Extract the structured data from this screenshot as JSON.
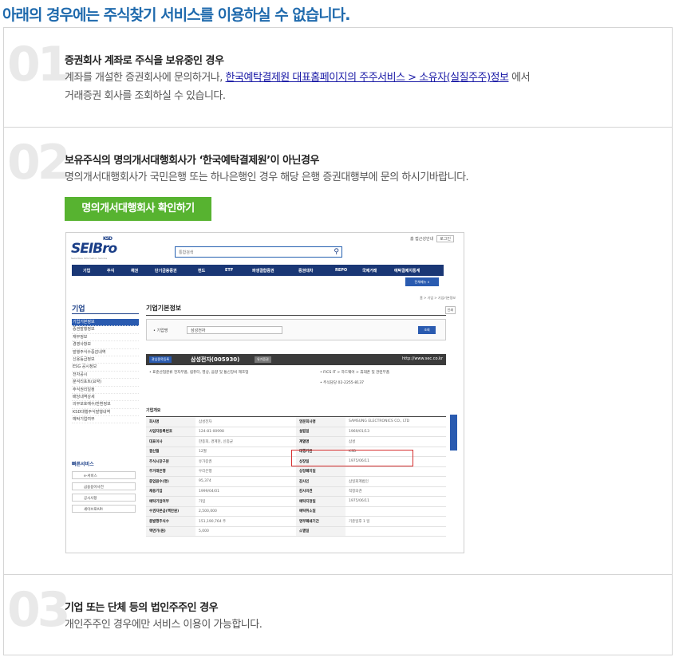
{
  "page_title": "아래의 경우에는 주식찾기 서비스를 이용하실 수 없습니다.",
  "sections": [
    {
      "number": "01",
      "heading": "증권회사 계좌로 주식을 보유중인 경우",
      "desc_prefix": "계좌를 개설한 증권회사에 문의하거나,",
      "link_text": "한국예탁결제원 대표홈페이지의 주주서비스 > 소유자(실질주주)정보",
      "desc_suffix": "에서",
      "desc_line2": "거래증권 회사를 조회하실 수 있습니다."
    },
    {
      "number": "02",
      "heading": "보유주식의 명의개서대행회사가 ‘한국예탁결제원’이 아닌경우",
      "desc": "명의개서대행회사가 국민은행 또는 하나은행인 경우 해당 은행 증권대행부에 문의 하시기바랍니다.",
      "button_label": "명의개서대행회사 확인하기"
    },
    {
      "number": "03",
      "heading": "기업 또는 단체 등의 법인주주인 경우",
      "desc": "개인주주인 경우에만 서비스 이용이 가능합니다."
    }
  ],
  "screenshot": {
    "top_links": "홈  접근성안내",
    "top_button": "로그인",
    "logo": "SEIBro",
    "logo_ksd": "KSD",
    "logo_sub": "Securities Information Service",
    "search_placeholder": "통합검색",
    "nav": [
      "기업",
      "주식",
      "채권",
      "단기금융증권",
      "펀드",
      "ETF",
      "파생결합증권",
      "증권대차",
      "REPO",
      "국제거래",
      "예탁결제지통계"
    ],
    "all_menu": "전체메뉴 ∨",
    "left_title": "기업",
    "left_menu": [
      "기업기본정보",
      "증권발행정보",
      "재무정보",
      "경영사항보",
      "발행주식수증감내역",
      "신용등급정보",
      "ESG 공시정보",
      "전자공시",
      "분석리포트(요약)",
      "주식권리일정",
      "배당내역상세",
      "의무보호예수/반환정보",
      "KSD대행주식발행내역",
      "예탁기업여부"
    ],
    "quick_title": "빠른서비스",
    "quick_items": [
      "e-서비스",
      "금융용어사전",
      "공시사항",
      "세이브로API"
    ],
    "main_title": "기업기본정보",
    "breadcrumb": "홈 > 기업 > 기업기본정보",
    "print_btn": "인쇄",
    "search_label": "• 기업명",
    "search_value": "삼성전자",
    "search_button": "조회",
    "company_tag": "관심종목등록",
    "company_name": "삼성전자(005930)",
    "company_tag2": "유가증권",
    "company_url": "http://www.sec.co.kr",
    "info_industry": "• 표준산업분류   전자부품, 컴퓨터, 영상, 음향 및 통신장비 제조업",
    "info_fics": "• FICS      IT > 하드웨어 > 휴대폰 및 관련부품",
    "info_contact": "• 주식담당   02-2255-8137",
    "table_title": "기업개요",
    "table_rows": [
      [
        "회사명",
        "삼성전자",
        "영문회사명",
        "SAMSUNG ELECTRONICS CO., LTD"
      ],
      [
        "사업자등록번호",
        "124-81-00998",
        "설립일",
        "1969/01/13"
      ],
      [
        "대표이사",
        "한종희, 경계현, 신종균",
        "계열명",
        "삼성"
      ],
      [
        "결산월",
        "12월",
        "대행기관",
        "KSD"
      ],
      [
        "주식시장구분",
        "유가증권",
        "상장일",
        "1975/06/11"
      ],
      [
        "주거래은행",
        "우리은행",
        "상장폐지일",
        ""
      ],
      [
        "종업원수(명)",
        "95,374",
        "감사인",
        "삼일회계법인"
      ],
      [
        "채용기업",
        "1999/04/01",
        "감사의견",
        "적정의견"
      ],
      [
        "예탁기업여부",
        "가입",
        "예탁지정일",
        "1975/06/11"
      ],
      [
        "수권자본금(백만원)",
        "2,500,000",
        "예탁취소일",
        ""
      ],
      [
        "총발행주식수",
        "151,190,764 주",
        "명부폐쇄기간",
        "기준일후 1 일"
      ],
      [
        "액면가(원)",
        "5,000",
        "소멸일",
        ""
      ]
    ]
  },
  "colors": {
    "title_blue": "#1f6aad",
    "button_green": "#57b330",
    "nav_navy": "#1a3775",
    "highlight_red": "#d62e2e"
  }
}
